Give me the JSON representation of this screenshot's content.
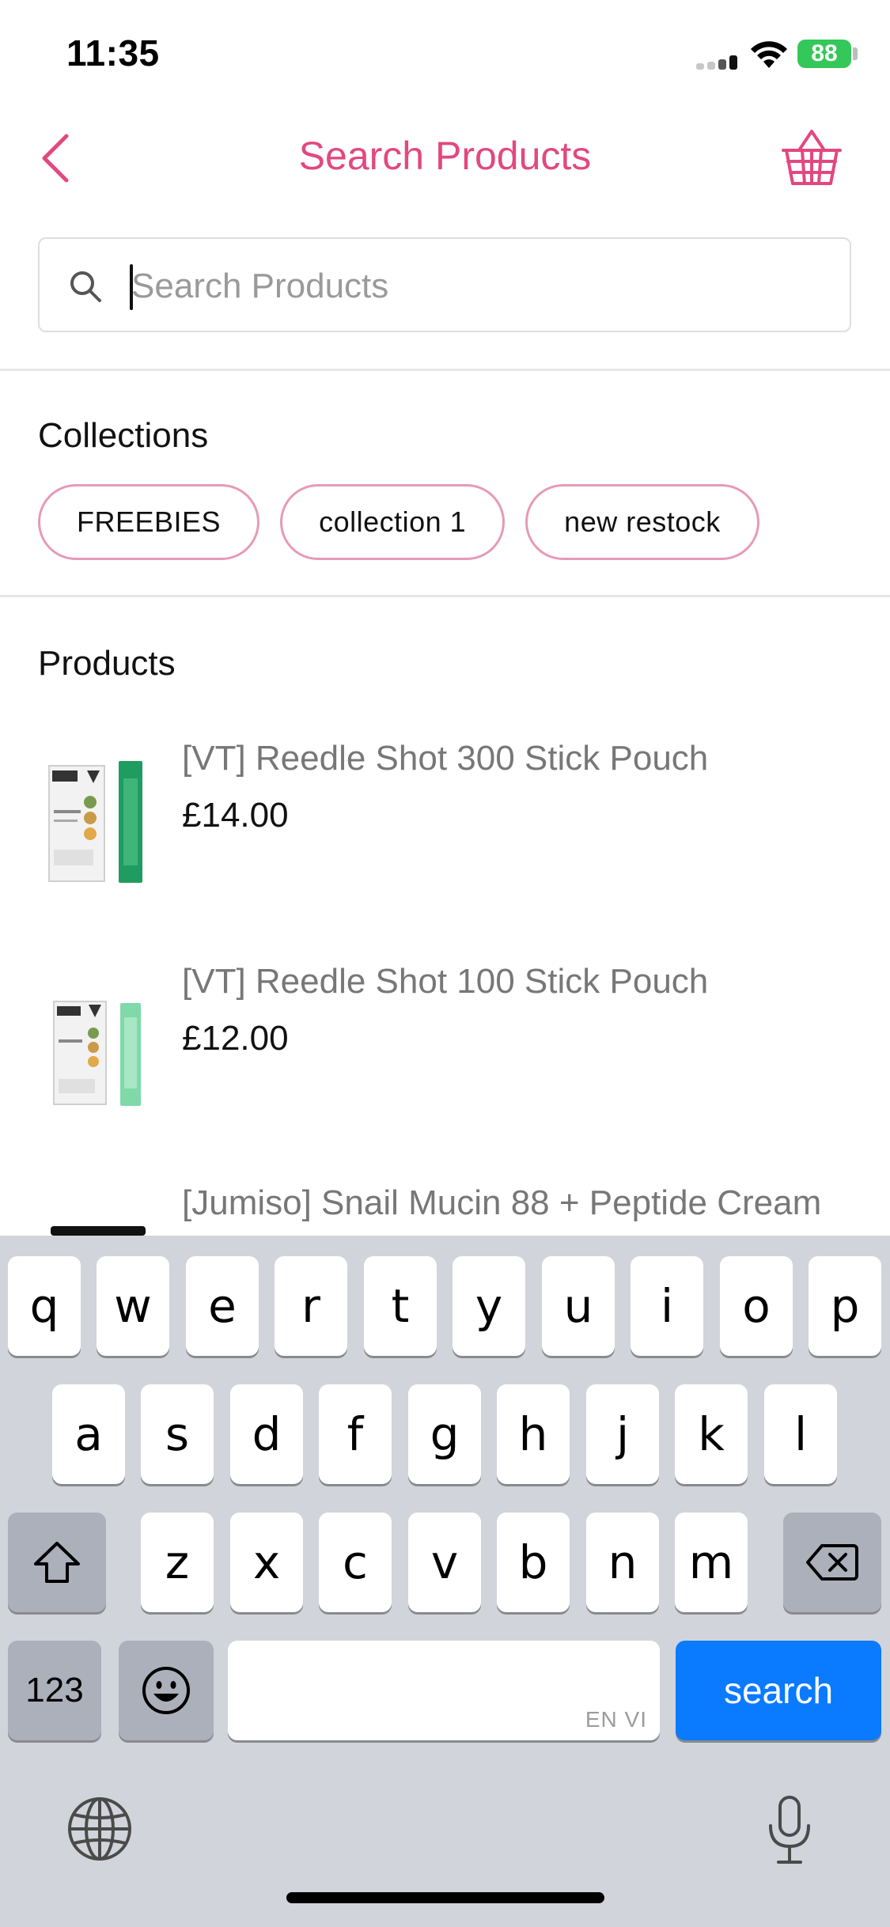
{
  "status_bar": {
    "time": "11:35",
    "battery": "88"
  },
  "header": {
    "title": "Search Products"
  },
  "search": {
    "placeholder": "Search Products",
    "value": ""
  },
  "collections": {
    "title": "Collections",
    "items": [
      "FREEBIES",
      "collection 1",
      "new restock"
    ]
  },
  "products": {
    "title": "Products",
    "items": [
      {
        "name": "[VT] Reedle Shot 300 Stick Pouch",
        "price": "£14.00"
      },
      {
        "name": "[VT] Reedle Shot 100 Stick Pouch",
        "price": "£12.00"
      },
      {
        "name": "[Jumiso] Snail Mucin 88 + Peptide Cream",
        "price": ""
      }
    ]
  },
  "keyboard": {
    "row1": [
      "q",
      "w",
      "e",
      "r",
      "t",
      "y",
      "u",
      "i",
      "o",
      "p"
    ],
    "row2": [
      "a",
      "s",
      "d",
      "f",
      "g",
      "h",
      "j",
      "k",
      "l"
    ],
    "row3": [
      "z",
      "x",
      "c",
      "v",
      "b",
      "n",
      "m"
    ],
    "numbers_key": "123",
    "space_lang": "EN VI",
    "return_key": "search"
  },
  "colors": {
    "accent": "#e2487f",
    "chip_border": "#e69ab7",
    "keyboard_bg": "#d1d4da",
    "return_key": "#0a7aff",
    "battery": "#34c759"
  },
  "icons": [
    "back-chevron-icon",
    "basket-icon",
    "search-icon",
    "shift-icon",
    "backspace-icon",
    "emoji-icon",
    "globe-icon",
    "microphone-icon",
    "wifi-icon",
    "signal-icon"
  ]
}
